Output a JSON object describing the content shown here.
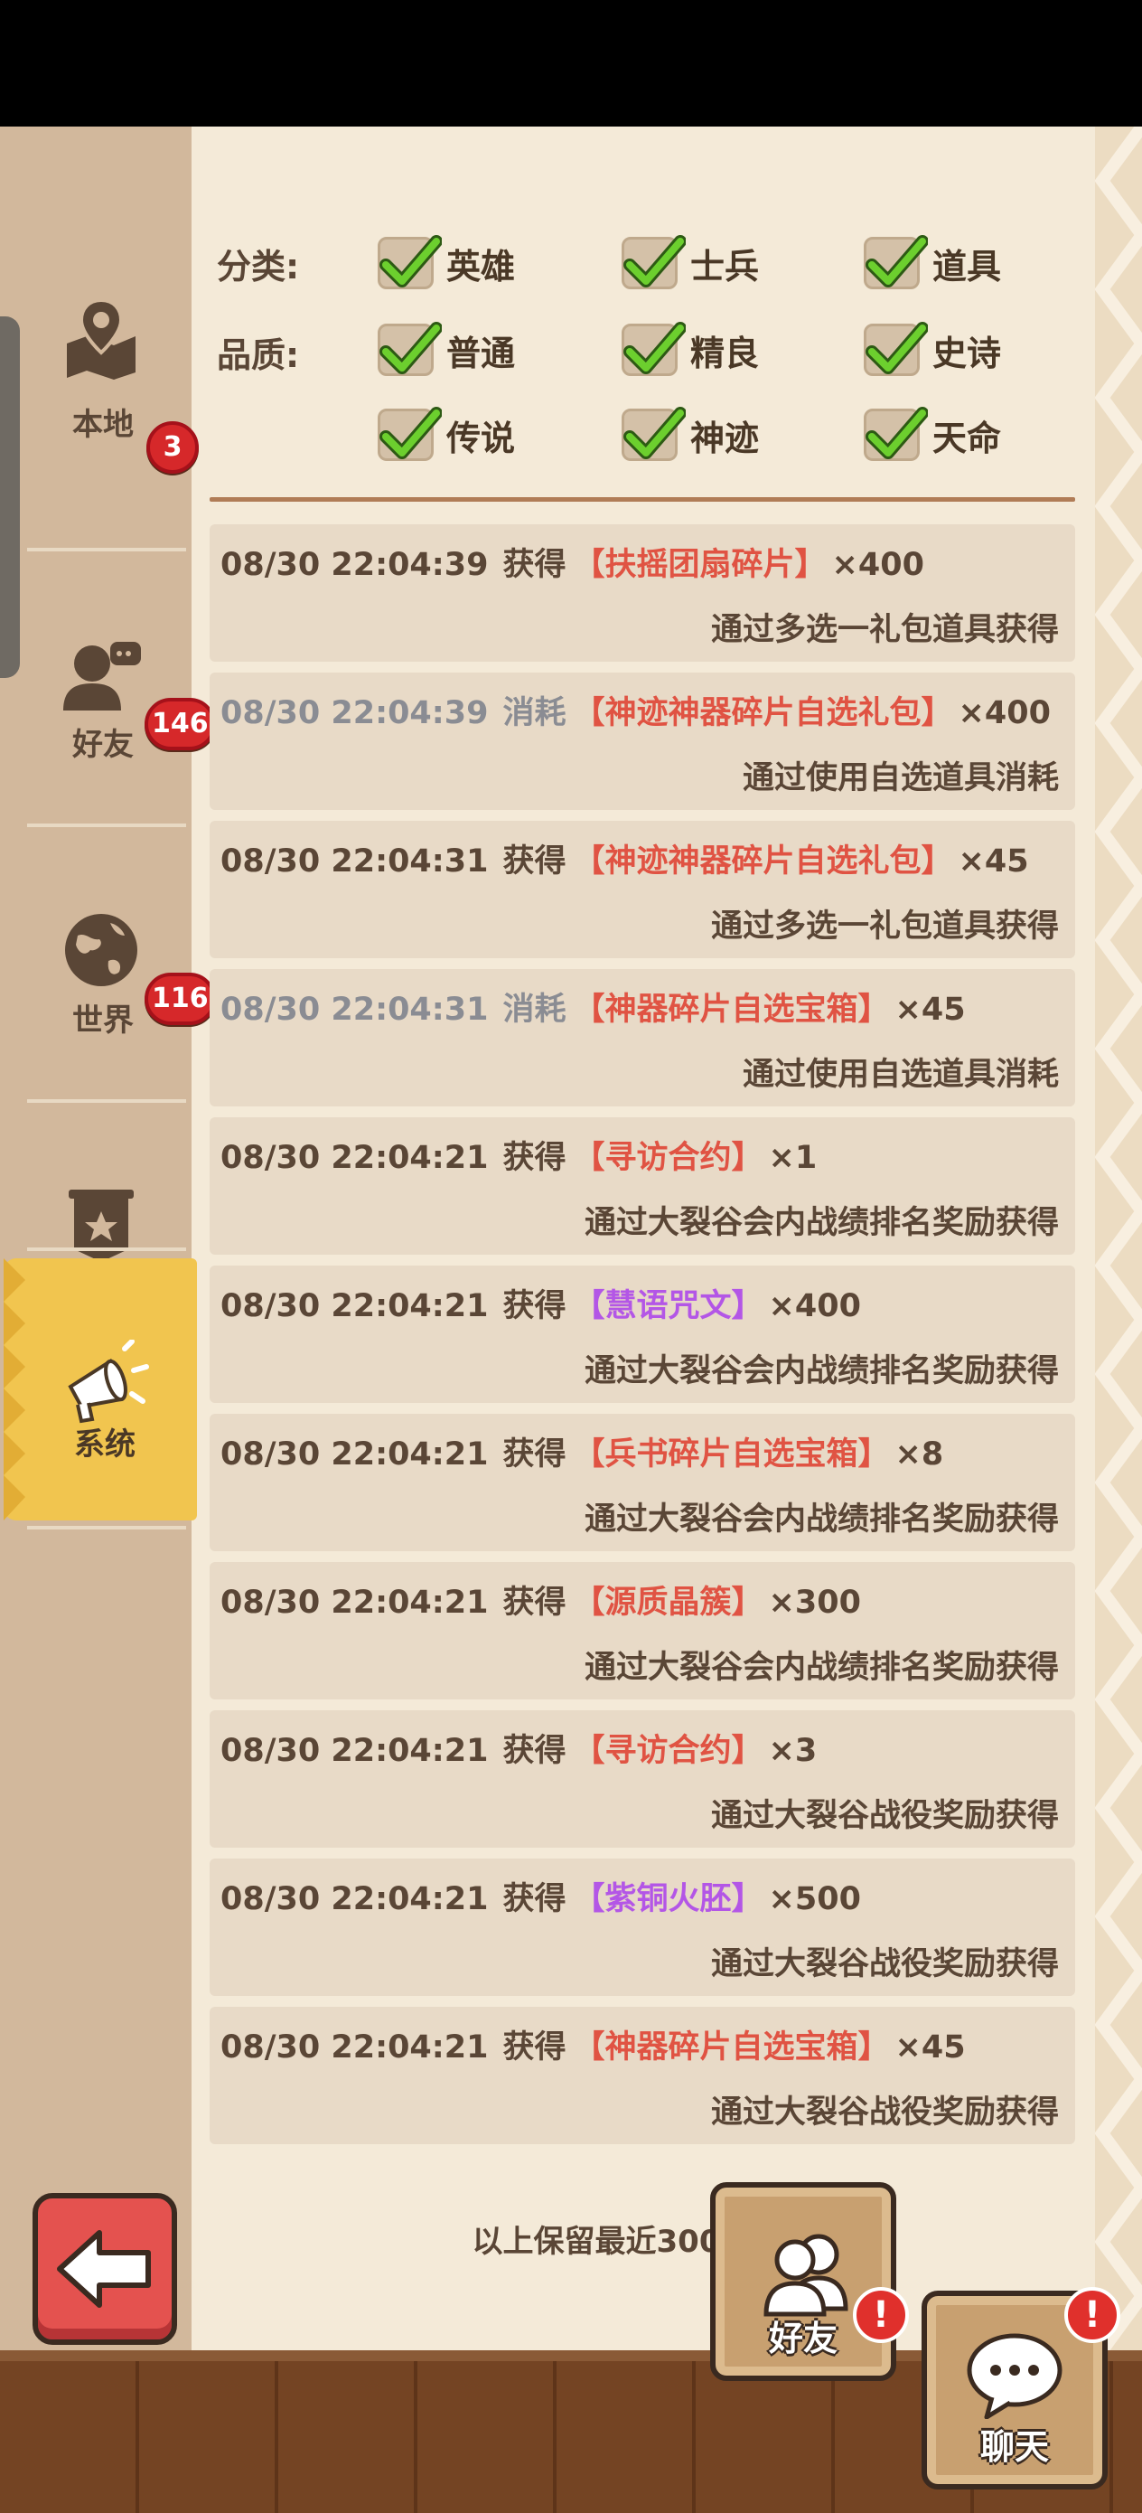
{
  "sidebar": {
    "items": [
      {
        "label": "本地",
        "icon": "map-icon"
      },
      {
        "label": "好友",
        "icon": "friend-icon",
        "badge": "3"
      },
      {
        "label": "世界",
        "icon": "globe-icon",
        "badge": "146"
      },
      {
        "label": "公会",
        "icon": "guild-banner-icon",
        "badge": "116"
      },
      {
        "label": "系统",
        "icon": "megaphone-icon",
        "active": true
      }
    ]
  },
  "filters": {
    "category_label": "分类:",
    "quality_label": "品质:",
    "category": [
      {
        "label": "英雄",
        "checked": true
      },
      {
        "label": "士兵",
        "checked": true
      },
      {
        "label": "道具",
        "checked": true
      }
    ],
    "quality": [
      {
        "label": "普通",
        "checked": true
      },
      {
        "label": "精良",
        "checked": true
      },
      {
        "label": "史诗",
        "checked": true
      },
      {
        "label": "传说",
        "checked": true
      },
      {
        "label": "神迹",
        "checked": true
      },
      {
        "label": "天命",
        "checked": true
      }
    ]
  },
  "records": [
    {
      "time": "08/30 22:04:39",
      "action": "获得",
      "item": "【扶摇团扇碎片】",
      "qty": "×400",
      "source": "通过多选一礼包道具获得",
      "style": "normal",
      "item_color": "red"
    },
    {
      "time": "08/30 22:04:39",
      "action": "消耗",
      "item": "【神迹神器碎片自选礼包】",
      "qty": "×400",
      "source": "通过使用自选道具消耗",
      "style": "gray",
      "item_color": "red"
    },
    {
      "time": "08/30 22:04:31",
      "action": "获得",
      "item": "【神迹神器碎片自选礼包】",
      "qty": "×45",
      "source": "通过多选一礼包道具获得",
      "style": "normal",
      "item_color": "red"
    },
    {
      "time": "08/30 22:04:31",
      "action": "消耗",
      "item": "【神器碎片自选宝箱】",
      "qty": "×45",
      "source": "通过使用自选道具消耗",
      "style": "gray",
      "item_color": "red"
    },
    {
      "time": "08/30 22:04:21",
      "action": "获得",
      "item": "【寻访合约】",
      "qty": "×1",
      "source": "通过大裂谷会内战绩排名奖励获得",
      "style": "normal",
      "item_color": "red"
    },
    {
      "time": "08/30 22:04:21",
      "action": "获得",
      "item": "【慧语咒文】",
      "qty": "×400",
      "source": "通过大裂谷会内战绩排名奖励获得",
      "style": "normal",
      "item_color": "purple"
    },
    {
      "time": "08/30 22:04:21",
      "action": "获得",
      "item": "【兵书碎片自选宝箱】",
      "qty": "×8",
      "source": "通过大裂谷会内战绩排名奖励获得",
      "style": "normal",
      "item_color": "red"
    },
    {
      "time": "08/30 22:04:21",
      "action": "获得",
      "item": "【源质晶簇】",
      "qty": "×300",
      "source": "通过大裂谷会内战绩排名奖励获得",
      "style": "normal",
      "item_color": "red"
    },
    {
      "time": "08/30 22:04:21",
      "action": "获得",
      "item": "【寻访合约】",
      "qty": "×3",
      "source": "通过大裂谷战役奖励获得",
      "style": "normal",
      "item_color": "red"
    },
    {
      "time": "08/30 22:04:21",
      "action": "获得",
      "item": "【紫铜火胚】",
      "qty": "×500",
      "source": "通过大裂谷战役奖励获得",
      "style": "normal",
      "item_color": "purple"
    },
    {
      "time": "08/30 22:04:21",
      "action": "获得",
      "item": "【神器碎片自选宝箱】",
      "qty": "×45",
      "source": "通过大裂谷战役奖励获得",
      "style": "normal",
      "item_color": "red"
    }
  ],
  "footer_note": "以上保留最近300条记录",
  "bottom": {
    "back_icon": "back-arrow-icon",
    "friends_label": "好友",
    "chat_label": "聊天",
    "alert_glyph": "!"
  },
  "colors": {
    "accent_yellow": "#f1c54f",
    "item_red": "#e05343",
    "item_purple": "#b356e6",
    "badge_red": "#d6282a"
  }
}
